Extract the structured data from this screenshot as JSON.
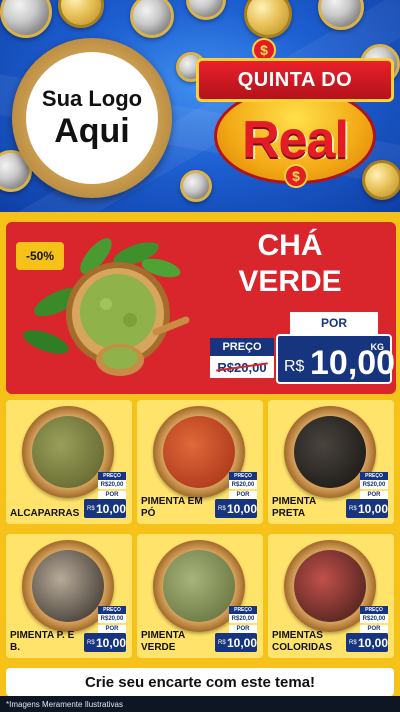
{
  "header": {
    "logo_line1": "Sua Logo",
    "logo_line2": "Aqui",
    "badge_top": "QUINTA DO",
    "badge_main": "Real",
    "badge_symbol": "$"
  },
  "hero": {
    "discount": "-50%",
    "title_line1": "CHÁ",
    "title_line2": "VERDE",
    "old_label": "PREÇO",
    "old_price": "R$20,00",
    "new_label": "POR",
    "currency": "R$",
    "price": "10,00",
    "unit": "KG"
  },
  "products": [
    {
      "name": "ALCAPARRAS",
      "old_label": "PREÇO",
      "old_price": "R$20,00",
      "new_label": "POR",
      "currency": "R$",
      "price": "10,00",
      "color": "#7a7e3a"
    },
    {
      "name": "PIMENTA EM PÓ",
      "old_label": "PREÇO",
      "old_price": "R$20,00",
      "new_label": "POR",
      "currency": "R$",
      "price": "10,00",
      "color": "#c4431e"
    },
    {
      "name": "PIMENTA PRETA",
      "old_label": "PREÇO",
      "old_price": "R$20,00",
      "new_label": "POR",
      "currency": "R$",
      "price": "10,00",
      "color": "#2a2623"
    },
    {
      "name": "PIMENTA P. E B.",
      "old_label": "PREÇO",
      "old_price": "R$20,00",
      "new_label": "POR",
      "currency": "R$",
      "price": "10,00",
      "color": "#5a5048"
    },
    {
      "name": "PIMENTA VERDE",
      "old_label": "PREÇO",
      "old_price": "R$20,00",
      "new_label": "POR",
      "currency": "R$",
      "price": "10,00",
      "color": "#7b8a52"
    },
    {
      "name": "PIMENTAS COLORIDAS",
      "old_label": "PREÇO",
      "old_price": "R$20,00",
      "new_label": "POR",
      "currency": "R$",
      "price": "10,00",
      "color": "#6a2a24"
    }
  ],
  "cta": "Crie seu encarte com este tema!",
  "footer_note": "*Imagens Meramente Ilustrativas",
  "colors": {
    "red": "#d8262c",
    "navy": "#16357e",
    "yellow": "#f6c21a",
    "blue": "#1d5fd1"
  }
}
